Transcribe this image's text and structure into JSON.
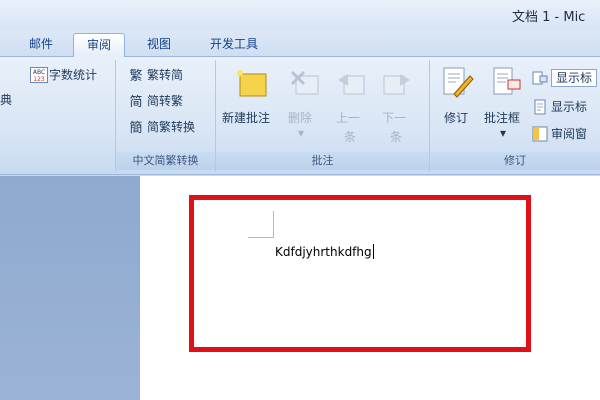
{
  "window": {
    "title": "文档 1 - Mic"
  },
  "tabs": [
    {
      "label": "邮件",
      "active": false
    },
    {
      "label": "审阅",
      "active": true
    },
    {
      "label": "视图",
      "active": false
    },
    {
      "label": "开发工具",
      "active": false
    }
  ],
  "proofing": {
    "word_count_label": "字数统计",
    "word_count_icon_text": "ABC\n123",
    "thesaurus_fragment": "词典"
  },
  "chinese_conversion": {
    "items": [
      {
        "label": "繁转简"
      },
      {
        "label": "简转繁"
      },
      {
        "label": "简繁转换"
      }
    ],
    "group_label": "中文简繁转换"
  },
  "comments": {
    "new_comment": "新建批注",
    "delete_line1": "删除",
    "delete_arrow": "▾",
    "prev_line1": "上一",
    "prev_line2": "条",
    "next_line1": "下一",
    "next_line2": "条",
    "group_label": "批注"
  },
  "tracking": {
    "track_changes": "修订",
    "balloons": "批注框",
    "dropdown_arrow": "▾",
    "display_for_review": "显示标",
    "show_markup": "显示标",
    "reviewing_pane": "审阅窗",
    "group_label": "修订"
  },
  "document": {
    "text": "Kdfdjyhrthkdfhg"
  },
  "colors": {
    "highlight_border": "#e01018",
    "ribbon_text": "#1e395b",
    "disabled_text": "#a8b4c4"
  }
}
